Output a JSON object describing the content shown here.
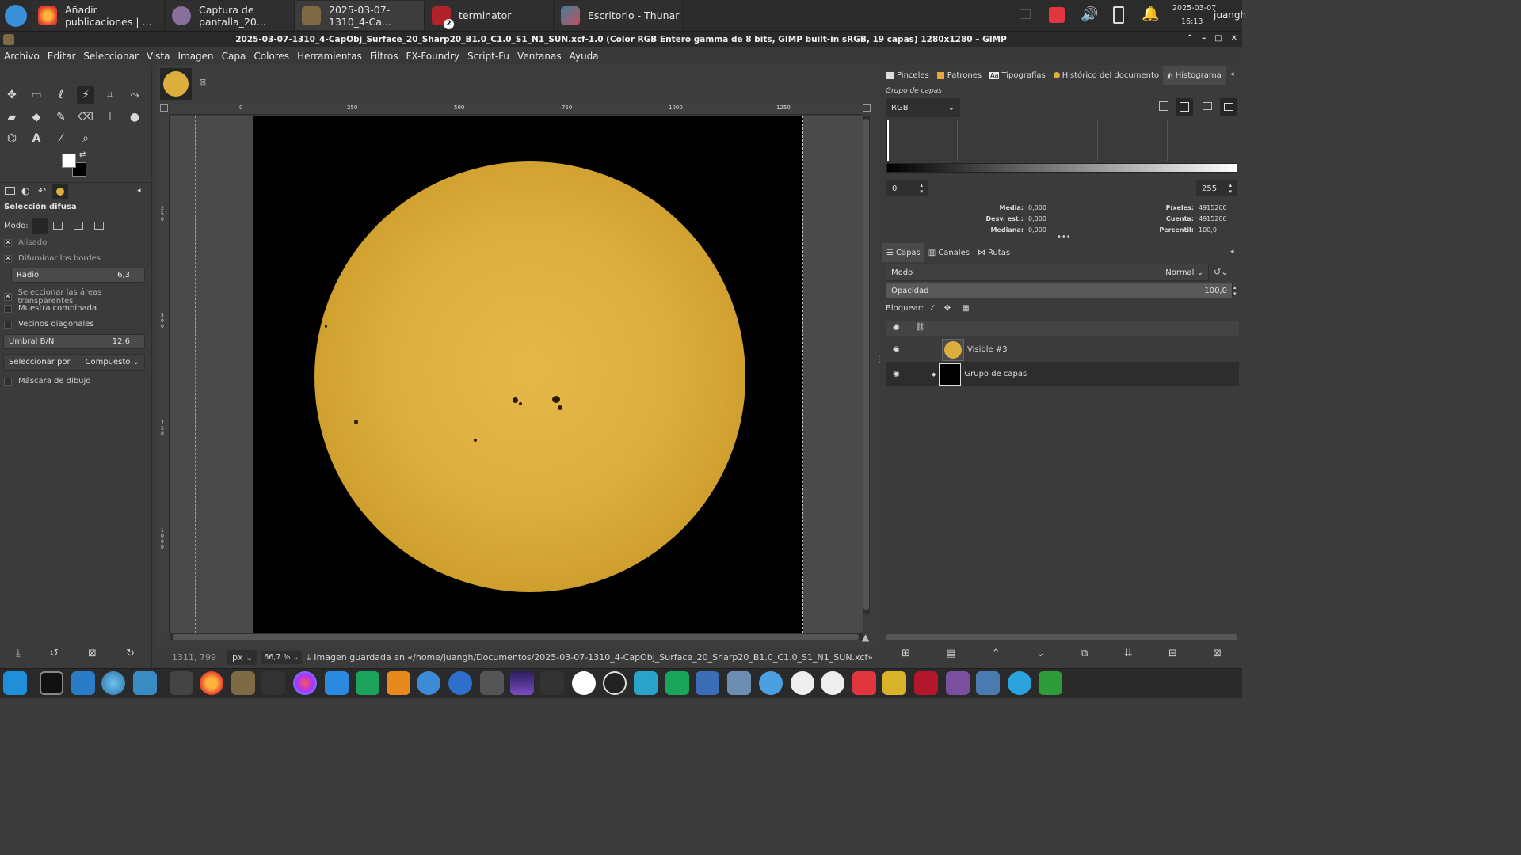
{
  "taskbar": {
    "tasks": [
      {
        "label": "Añadir publicaciones | ..."
      },
      {
        "label": "Captura de pantalla_20..."
      },
      {
        "label": "2025-03-07-1310_4-Ca..."
      },
      {
        "label": "terminator",
        "badge": "2"
      },
      {
        "label": "Escritorio - Thunar"
      }
    ],
    "date": "2025-03-07",
    "time": "16:13",
    "user": "juangh"
  },
  "window": {
    "title": "2025-03-07-1310_4-CapObj_Surface_20_Sharp20_B1.0_C1.0_S1_N1_SUN.xcf-1.0 (Color RGB Entero gamma de 8 bits, GIMP built-in sRGB, 19 capas) 1280x1280 – GIMP"
  },
  "menu": [
    "Archivo",
    "Editar",
    "Seleccionar",
    "Vista",
    "Imagen",
    "Capa",
    "Colores",
    "Herramientas",
    "Filtros",
    "FX-Foundry",
    "Script-Fu",
    "Ventanas",
    "Ayuda"
  ],
  "tool_options": {
    "title": "Selección difusa",
    "mode_label": "Modo:",
    "antialias": "Alisado",
    "feather": "Difuminar los bordes",
    "radius_label": "Radio",
    "radius_value": "6,3",
    "select_transparent": "Seleccionar las áreas transparentes",
    "sample_merged": "Muestra combinada",
    "diagonal": "Vecinos diagonales",
    "threshold_label": "Umbral B/N",
    "threshold_value": "12,6",
    "select_by_label": "Seleccionar por",
    "select_by_value": "Compuesto",
    "draw_mask": "Máscara de dibujo"
  },
  "rulers": {
    "top": [
      "0",
      "250",
      "500",
      "750",
      "1000",
      "1250"
    ],
    "left": [
      "2 5 0",
      "5 0 0",
      "7 5 0",
      "1 0 0 0"
    ]
  },
  "status": {
    "coords": "1311, 799",
    "unit": "px",
    "zoom": "66,7 %",
    "message": "Imagen guardada en «/home/juangh/Documentos/2025-03-07-1310_4-CapObj_Surface_20_Sharp20_B1.0_C1.0_S1_N1_SUN.xcf»"
  },
  "dock_top": {
    "tabs": [
      "Pinceles",
      "Patrones",
      "Tipografías",
      "Histórico del documento",
      "Histograma"
    ],
    "group_label": "Grupo de capas",
    "channel": "RGB",
    "range_min": "0",
    "range_max": "255",
    "stats_left": [
      {
        "label": "Media:",
        "value": "0,000"
      },
      {
        "label": "Desv. est.:",
        "value": "0,000"
      },
      {
        "label": "Mediana:",
        "value": "0,000"
      }
    ],
    "stats_right": [
      {
        "label": "Píxeles:",
        "value": "4915200"
      },
      {
        "label": "Cuenta:",
        "value": "4915200"
      },
      {
        "label": "Percentil:",
        "value": "100,0"
      }
    ]
  },
  "layers": {
    "tabs": [
      "Capas",
      "Canales",
      "Rutas"
    ],
    "mode_label": "Modo",
    "mode_value": "Normal",
    "opacity_label": "Opacidad",
    "opacity_value": "100,0",
    "lock_label": "Bloquear:",
    "items": [
      {
        "name": "Visible #3"
      },
      {
        "name": "Grupo de capas"
      }
    ]
  },
  "colors": {
    "sun": "#dcae3e",
    "accent_red": "#e0363f"
  }
}
